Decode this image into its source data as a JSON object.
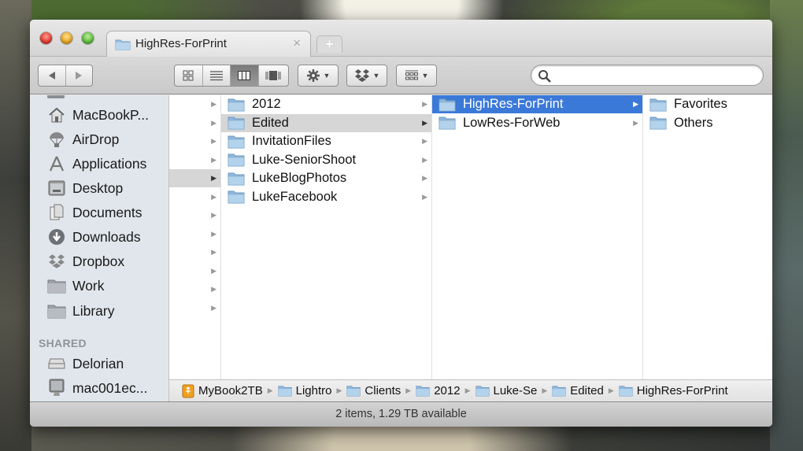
{
  "window": {
    "tab_title": "HighRes-ForPrint",
    "new_tab_label": "+",
    "close_tab_glyph": "×"
  },
  "toolbar": {
    "back_icon": "back-arrow-icon",
    "forward_icon": "forward-arrow-icon",
    "view_modes": [
      "icon-view",
      "list-view",
      "column-view",
      "coverflow-view"
    ],
    "active_view": "column-view",
    "action_menu_icon": "gear-icon",
    "dropbox_menu_icon": "dropbox-icon",
    "arrange_menu_icon": "arrange-icon",
    "search": {
      "value": "",
      "placeholder": ""
    }
  },
  "sidebar": {
    "items": [
      {
        "label": "MacBookP...",
        "icon": "home-icon"
      },
      {
        "label": "AirDrop",
        "icon": "airdrop-icon"
      },
      {
        "label": "Applications",
        "icon": "applications-icon"
      },
      {
        "label": "Desktop",
        "icon": "desktop-icon"
      },
      {
        "label": "Documents",
        "icon": "documents-icon"
      },
      {
        "label": "Downloads",
        "icon": "downloads-icon"
      },
      {
        "label": "Dropbox",
        "icon": "dropbox-icon"
      },
      {
        "label": "Work",
        "icon": "folder-icon"
      },
      {
        "label": "Library",
        "icon": "folder-icon"
      }
    ],
    "shared_header": "SHARED",
    "shared": [
      {
        "label": "Delorian",
        "icon": "server-icon"
      },
      {
        "label": "mac001ec...",
        "icon": "computer-icon"
      }
    ]
  },
  "columns": [
    {
      "rows": [
        "",
        "",
        "",
        "",
        "",
        "",
        "",
        "",
        "",
        "",
        "",
        ""
      ],
      "selected_index": 4
    },
    {
      "rows": [
        "2012",
        "Edited",
        "InvitationFiles",
        "Luke-SeniorShoot",
        "LukeBlogPhotos",
        "LukeFacebook"
      ],
      "selected_index": 1
    },
    {
      "rows": [
        "HighRes-ForPrint",
        "LowRes-ForWeb"
      ],
      "selected_index": 0
    },
    {
      "rows": [
        "Favorites",
        "Others"
      ],
      "selected_index": -1
    }
  ],
  "pathbar": {
    "crumbs": [
      "MyBook2TB",
      "Lightro",
      "Clients",
      "2012",
      "Luke-Se",
      "Edited",
      "HighRes-ForPrint"
    ]
  },
  "status": {
    "text": "2 items, 1.29 TB available"
  }
}
